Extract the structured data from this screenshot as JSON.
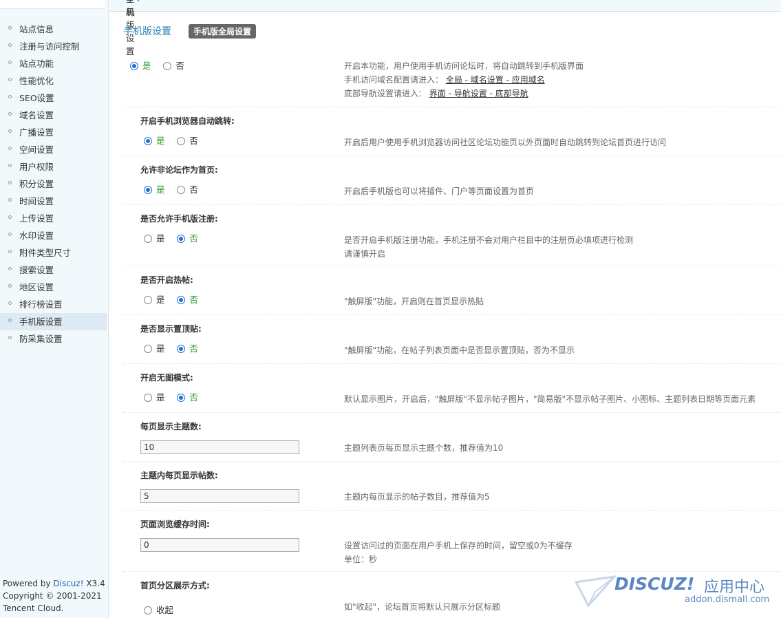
{
  "breadcrumb": {
    "root": "全局",
    "sep": "»",
    "current": "手机版设置",
    "plus": "[+]"
  },
  "sidebar": {
    "items": [
      "站点信息",
      "注册与访问控制",
      "站点功能",
      "性能优化",
      "SEO设置",
      "域名设置",
      "广播设置",
      "空间设置",
      "用户权限",
      "积分设置",
      "时间设置",
      "上传设置",
      "水印设置",
      "附件类型尺寸",
      "搜索设置",
      "地区设置",
      "排行榜设置",
      "手机版设置",
      "防采集设置"
    ],
    "active_index": 17
  },
  "powered": {
    "line1_prefix": "Powered by ",
    "brand": "Discuz!",
    "version": " X3.4",
    "line2": "Copyright © 2001-2021",
    "line3": "Tencent Cloud."
  },
  "page": {
    "title": "手机版设置",
    "tab": "手机版全局设置"
  },
  "opts": {
    "yes": "是",
    "no": "否",
    "collapse": "收起"
  },
  "settings": {
    "mobile_enable": {
      "selected": "yes",
      "tip1": "开启本功能，用户使用手机访问论坛时，将自动跳转到手机版界面",
      "tip2_prefix": "手机访问域名配置请进入：",
      "tip2_link": "全局 - 域名设置 - 应用域名",
      "tip3_prefix": "底部导航设置请进入：",
      "tip3_link": "界面 - 导航设置 - 底部导航"
    },
    "auto_jump": {
      "label": "开启手机浏览器自动跳转:",
      "selected": "yes",
      "tip": "开启后用户使用手机浏览器访问社区论坛功能页以外页面时自动跳转到论坛首页进行访问"
    },
    "non_forum_home": {
      "label": "允许非论坛作为首页:",
      "selected": "yes",
      "tip": "开启后手机版也可以将插件、门户等页面设置为首页"
    },
    "mobile_register": {
      "label": "是否允许手机版注册:",
      "selected": "no",
      "tip1": "是否开启手机版注册功能，手机注册不会对用户栏目中的注册页必填项进行检测",
      "tip2": "请谨慎开启"
    },
    "hot_threads": {
      "label": "是否开启热帖:",
      "selected": "no",
      "tip": "\"触屏版\"功能，开启则在首页显示热贴"
    },
    "sticky_threads": {
      "label": "是否显示置顶贴:",
      "selected": "no",
      "tip": "\"触屏版\"功能，在帖子列表页面中是否显示置顶贴，否为不显示"
    },
    "no_image": {
      "label": "开启无图模式:",
      "selected": "no",
      "tip": "默认显示图片，开启后，\"触屏版\"不显示帖子图片，\"简易版\"不显示帖子图片、小图标、主题列表日期等页面元素"
    },
    "topics_per_page": {
      "label": "每页显示主题数:",
      "value": "10",
      "tip": "主题列表页每页显示主题个数，推荐值为10"
    },
    "posts_per_page": {
      "label": "主题内每页显示帖数:",
      "value": "5",
      "tip": "主题内每页显示的帖子数目，推荐值为5"
    },
    "cache_time": {
      "label": "页面浏览缓存时间:",
      "value": "0",
      "tip1": "设置访问过的页面在用户手机上保存的时间，留空或0为不缓存",
      "tip2": "单位：秒"
    },
    "home_forum_display": {
      "label": "首页分区展示方式:",
      "selected": "collapse",
      "tip": "如\"收起\"，论坛首页将默认只展示分区标题"
    }
  },
  "watermark": {
    "word": "DISCUZ!",
    "cn": "应用中心",
    "url": "addon.dismall.com"
  },
  "colors": {
    "accent": "#2883b5",
    "selected": "#2d9a2d",
    "radio": "#1f6fd6",
    "sidebar_bg": "#f2f9fd",
    "logo": "#5b86c4"
  }
}
